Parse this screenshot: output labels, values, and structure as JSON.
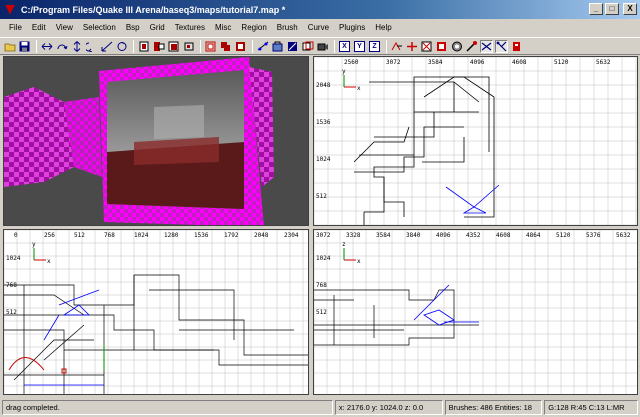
{
  "window": {
    "title": "C:/Program Files/Quake III Arena/baseq3/maps/tutorial7.map *",
    "minimize": "_",
    "maximize": "□",
    "close": "X"
  },
  "menu": [
    "File",
    "Edit",
    "View",
    "Selection",
    "Bsp",
    "Grid",
    "Textures",
    "Misc",
    "Region",
    "Brush",
    "Curve",
    "Plugins",
    "Help"
  ],
  "toolbar": {
    "axis_x": "X",
    "axis_y": "Y",
    "axis_z": "Z"
  },
  "viewports": {
    "top_right": {
      "ruler_top": [
        "2560",
        "3072",
        "3584",
        "4096",
        "4608",
        "5120",
        "5632"
      ],
      "ruler_left": [
        "2048",
        "1536",
        "1024",
        "512"
      ],
      "axis_h": "x",
      "axis_v": "y"
    },
    "bottom_left": {
      "ruler_top": [
        "0",
        "256",
        "512",
        "768",
        "1024",
        "1280",
        "1536",
        "1792",
        "2048",
        "2304"
      ],
      "ruler_left": [
        "1024",
        "768",
        "512"
      ],
      "axis_h": "x",
      "axis_v": "y"
    },
    "bottom_right": {
      "ruler_top": [
        "3072",
        "3328",
        "3584",
        "3840",
        "4096",
        "4352",
        "4608",
        "4864",
        "5120",
        "5376",
        "5632"
      ],
      "ruler_left": [
        "1024",
        "768",
        "512"
      ],
      "axis_h": "x",
      "axis_v": "z"
    }
  },
  "status": {
    "message": "drag completed.",
    "coords": "x: 2176.0  y: 1024.0  z: 0.0",
    "brushes": "Brushes: 486  Entities: 18",
    "grid": "G:128 R:45 C:13 L:MR"
  },
  "colors": {
    "title_start": "#0a246a",
    "title_end": "#a6caf0",
    "face_brand": "#e020e0",
    "selection": "#0000ff",
    "brush_line": "#000000",
    "grid": "#c0c0c0"
  }
}
